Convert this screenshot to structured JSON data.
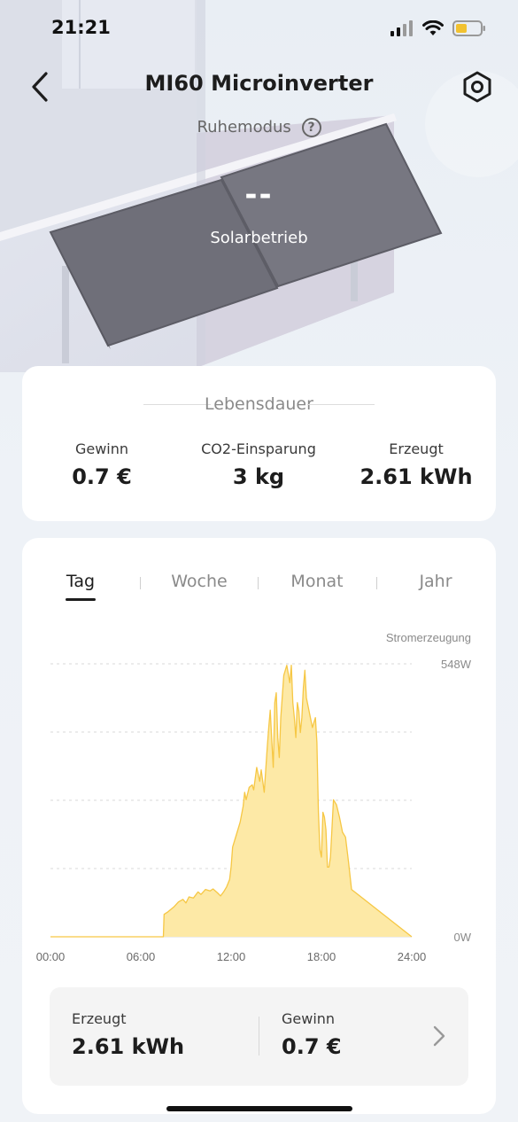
{
  "status_bar": {
    "time": "21:21"
  },
  "header": {
    "title": "MI60 Microinverter"
  },
  "device": {
    "mode_label": "Ruhemodus",
    "help_symbol": "?",
    "power_value": "--",
    "power_label": "Solarbetrieb"
  },
  "lifetime": {
    "title": "Lebensdauer",
    "stats": [
      {
        "label": "Gewinn",
        "value": "0.7 €"
      },
      {
        "label": "CO2-Einsparung",
        "value": "3 kg"
      },
      {
        "label": "Erzeugt",
        "value": "2.61 kWh"
      }
    ]
  },
  "tabs": [
    {
      "label": "Tag",
      "active": true
    },
    {
      "label": "Woche",
      "active": false
    },
    {
      "label": "Monat",
      "active": false
    },
    {
      "label": "Jahr",
      "active": false
    }
  ],
  "chart_data": {
    "type": "area",
    "ylabel": "Stromerzeugung",
    "x_ticks": [
      "00:00",
      "06:00",
      "12:00",
      "18:00",
      "24:00"
    ],
    "y_tick_labels": [
      "548W",
      "0W"
    ],
    "ylim": [
      0,
      548
    ],
    "xlim": [
      0,
      24
    ],
    "grid": "horizontal-dashed",
    "color": "#f6c744",
    "fill": "#fde9a6",
    "series": [
      {
        "x": [
          0,
          7.5,
          7.55,
          7.8,
          8.2,
          8.5,
          8.8,
          9.0,
          9.2,
          9.5,
          9.8,
          10.0,
          10.3,
          10.6,
          10.8,
          11.1,
          11.3,
          11.5,
          11.7,
          11.9,
          12.0,
          12.1,
          12.4,
          12.6,
          12.8,
          12.9,
          13.0,
          13.2,
          13.4,
          13.5,
          13.7,
          13.9,
          14.0,
          14.2,
          14.4,
          14.5,
          14.6,
          14.7,
          14.8,
          14.9,
          15.0,
          15.1,
          15.2,
          15.3,
          15.5,
          15.7,
          15.9,
          16.0,
          16.1,
          16.2,
          16.3,
          16.4,
          16.5,
          16.6,
          16.7,
          16.8,
          16.9,
          17.0,
          17.2,
          17.4,
          17.5,
          17.6,
          17.7,
          17.8,
          17.9,
          18.0,
          18.1,
          18.2,
          18.3,
          18.4,
          18.5,
          18.6,
          18.8,
          19.0,
          19.2,
          19.4,
          19.6,
          19.8,
          20.0,
          24
        ],
        "values": [
          0,
          0,
          45,
          50,
          60,
          70,
          75,
          68,
          80,
          78,
          90,
          85,
          95,
          92,
          96,
          88,
          82,
          90,
          100,
          115,
          140,
          180,
          210,
          230,
          262,
          290,
          275,
          300,
          305,
          295,
          340,
          312,
          335,
          290,
          380,
          420,
          455,
          395,
          340,
          470,
          490,
          400,
          360,
          440,
          525,
          545,
          510,
          545,
          470,
          440,
          400,
          470,
          453,
          410,
          440,
          500,
          535,
          480,
          450,
          420,
          430,
          440,
          390,
          250,
          175,
          160,
          250,
          240,
          215,
          140,
          140,
          160,
          275,
          265,
          240,
          210,
          200,
          150,
          95,
          0
        ]
      }
    ]
  },
  "summary": {
    "produced_label": "Erzeugt",
    "produced_value": "2.61 kWh",
    "profit_label": "Gewinn",
    "profit_value": "0.7 €"
  }
}
